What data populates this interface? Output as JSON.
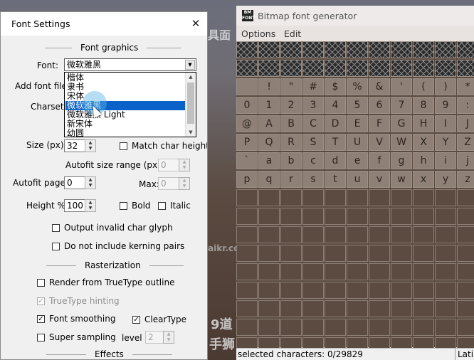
{
  "background": {
    "fragments": [
      "具面",
      "aikr.com",
      "9道",
      "手狮"
    ]
  },
  "font_settings": {
    "title": "Font Settings",
    "close_glyph": "✕",
    "font_graphics_header": "Font graphics",
    "font_label": "Font:",
    "font_value": "微软雅黑",
    "font_options": [
      "楷体",
      "隶书",
      "宋体",
      "微软雅黑",
      "微软雅黑 Light",
      "新宋体",
      "幼圆"
    ],
    "font_selected_index": 3,
    "add_font_file_label": "Add font file:",
    "charset_label": "Charset:",
    "size_label": "Size (px):",
    "size_value": "32",
    "match_char_height_label": "Match char height",
    "match_char_height_checked": false,
    "autofit_range_label": "Autofit size range (px) Min:",
    "autofit_min_value": "0",
    "autofit_pages_label": "Autofit pages:",
    "autofit_pages_value": "0",
    "max_label": "Max:",
    "max_value": "0",
    "height_label": "Height %:",
    "height_value": "100",
    "bold_label": "Bold",
    "bold_checked": false,
    "italic_label": "Italic",
    "italic_checked": false,
    "output_invalid_label": "Output invalid char glyph",
    "output_invalid_checked": false,
    "no_kerning_label": "Do not include kerning pairs",
    "no_kerning_checked": false,
    "rasterization_header": "Rasterization",
    "render_truetype_label": "Render from TrueType outline",
    "render_truetype_checked": false,
    "truetype_hinting_label": "TrueType hinting",
    "truetype_hinting_checked": true,
    "font_smoothing_label": "Font smoothing",
    "font_smoothing_checked": true,
    "cleartype_label": "ClearType",
    "cleartype_checked": true,
    "super_sampling_label": "Super sampling",
    "super_sampling_checked": false,
    "level_label": "level",
    "level_value": "2",
    "effects_header": "Effects"
  },
  "bmfont": {
    "title": "Bitmap font generator",
    "logo_text": "BM FONT",
    "menu": [
      "Options",
      "Edit"
    ],
    "rows": [
      [
        "",
        "",
        "",
        "",
        "",
        "",
        "",
        "",
        "",
        "",
        ""
      ],
      [
        "",
        "",
        "",
        "",
        "",
        "",
        "",
        "",
        "",
        "",
        ""
      ],
      [
        "",
        "!",
        "\"",
        "#",
        "$",
        "%",
        "&",
        "'",
        "(",
        ")",
        "*"
      ],
      [
        "0",
        "1",
        "2",
        "3",
        "4",
        "5",
        "6",
        "7",
        "8",
        "9",
        ":"
      ],
      [
        "@",
        "A",
        "B",
        "C",
        "D",
        "E",
        "F",
        "G",
        "H",
        "I",
        "J"
      ],
      [
        "P",
        "Q",
        "R",
        "S",
        "T",
        "U",
        "V",
        "W",
        "X",
        "Y",
        "Z"
      ],
      [
        "`",
        "a",
        "b",
        "c",
        "d",
        "e",
        "f",
        "g",
        "h",
        "i",
        "j"
      ],
      [
        "p",
        "q",
        "r",
        "s",
        "t",
        "u",
        "v",
        "w",
        "x",
        "y",
        "z"
      ]
    ],
    "status_left": "selected characters: 0/29829",
    "status_right": "Latin"
  }
}
